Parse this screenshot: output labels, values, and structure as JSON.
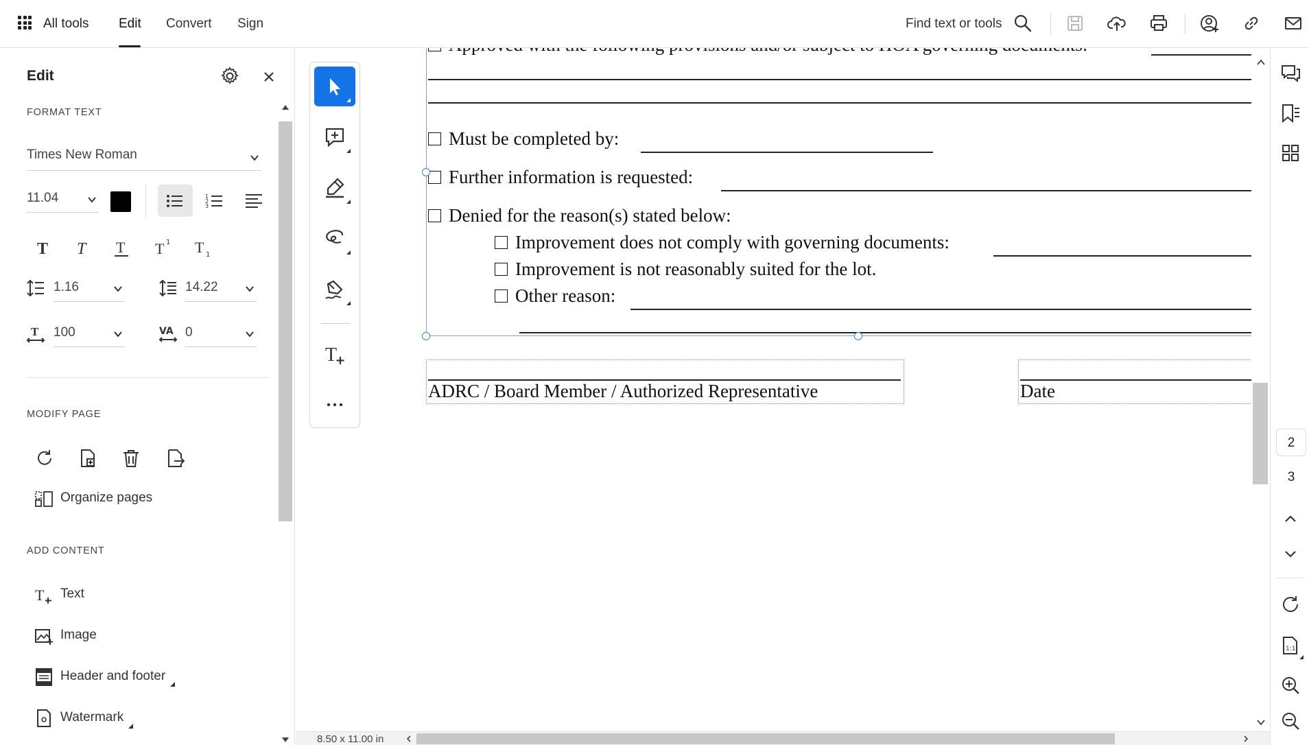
{
  "topbar": {
    "all_tools": "All tools",
    "tabs": [
      {
        "label": "Edit",
        "active": true
      },
      {
        "label": "Convert",
        "active": false
      },
      {
        "label": "Sign",
        "active": false
      }
    ],
    "search_placeholder": "Find text or tools"
  },
  "panel": {
    "title": "Edit",
    "format_text": {
      "section": "FORMAT TEXT",
      "font": "Times New Roman",
      "size": "11.04",
      "color": "#000000",
      "line_spacing": "1.16",
      "paragraph_spacing": "14.22",
      "horizontal_scale": "100",
      "char_spacing": "0"
    },
    "modify_page": {
      "section": "MODIFY PAGE",
      "organize": "Organize pages"
    },
    "add_content": {
      "section": "ADD CONTENT",
      "items": [
        "Text",
        "Image",
        "Header and footer",
        "Watermark"
      ]
    }
  },
  "document": {
    "top_partial": "Approved with the following provisions and/or subject to HOA governing documents:",
    "must_complete": "Must be completed by:",
    "further_info": "Further information is requested:",
    "denied": "Denied for the reason(s) stated below:",
    "reason_1": "Improvement does not comply with governing documents:",
    "reason_2": "Improvement is not reasonably suited for the lot.",
    "reason_3": "Other reason:",
    "signature_label": "ADRC / Board Member / Authorized Representative",
    "date_label": "Date"
  },
  "status": {
    "page_size": "8.50 x 11.00 in"
  },
  "pages": {
    "current": "2",
    "next": "3"
  }
}
